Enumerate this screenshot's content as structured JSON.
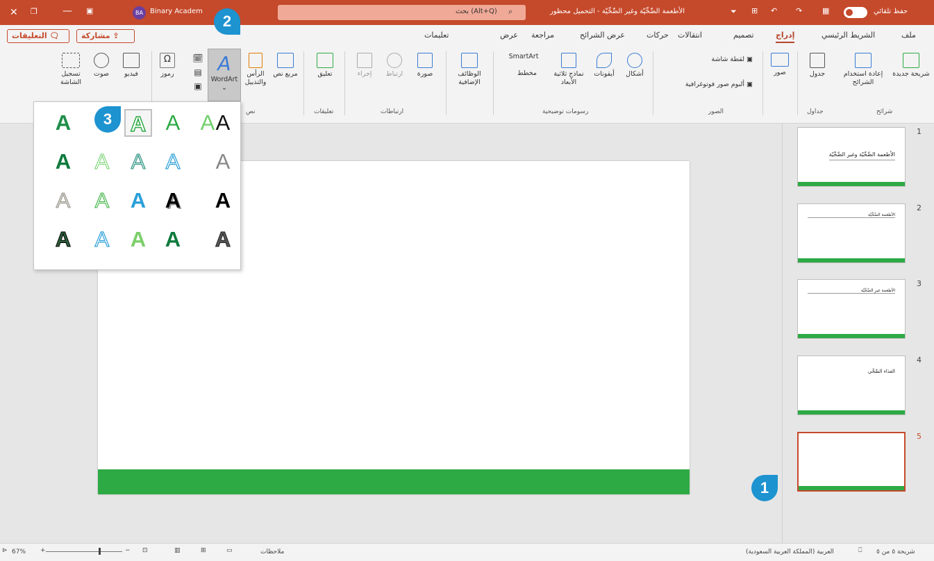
{
  "titlebar": {
    "autosave": "حفظ تلقائي",
    "doc_title": "الأطعمة الصِّحِّيّة وغير الصِّحِّيّة - التحميل محظور",
    "search_placeholder": "بحث (Alt+Q)",
    "user_initials": "BA",
    "user_name": "Binary Academ"
  },
  "menu": {
    "items": [
      "ملف",
      "الشريط الرئيسي",
      "إدراج",
      "تصميم",
      "انتقالات",
      "حركات",
      "عرض الشرائح",
      "مراجعة",
      "عرض",
      "تعليمات"
    ],
    "share": "مشاركة",
    "comments": "التعليقات"
  },
  "ribbon": {
    "new_slide": "شريحة جديدة",
    "reuse": "إعادة استخدام الشرائح",
    "table": "جدول",
    "images": "صور",
    "screenshot": "لقطة شاشة",
    "photo_album": "ألبوم صور فوتوغرافية",
    "shapes": "أشكال",
    "icons": "أيقونات",
    "models_3d": "نماذج ثلاثية الأبعاد",
    "smartart": "SmartArt",
    "chart": "مخطط",
    "addins": "الوظائف الإضافية",
    "zoom": "صورة",
    "link": "ارتباط",
    "action": "إجراء",
    "comment": "تعليق",
    "textbox": "مربع نص",
    "header_footer": "الرأس والتذييل",
    "wordart": "WordArt",
    "symbols": "رموز",
    "video": "فيديو",
    "audio": "صوت",
    "screen_recording": "تسجيل الشاشة",
    "groups": {
      "slides": "شرائح",
      "tables": "جداول",
      "images": "الصور",
      "illustrations": "رسومات توضيحية",
      "links": "ارتباطات",
      "comments": "تعليقات",
      "text": "نص"
    }
  },
  "thumbnails": [
    {
      "num": "1",
      "text": "الأطعمة الصِّحِّيّة وغير الصِّحِّيّة"
    },
    {
      "num": "2",
      "text": "الأطعمة الصِّحِّيّة"
    },
    {
      "num": "3",
      "text": "الأطعمة غير الصِّحِّيّة"
    },
    {
      "num": "4",
      "text": "الغذاء الصِّحِّي"
    },
    {
      "num": "5",
      "text": ""
    }
  ],
  "wordart_glyph": "A",
  "badges": [
    "1",
    "2",
    "3"
  ],
  "status": {
    "slide_info": "شريحة ٥ من ٥",
    "language": "العربية (المملكة العربية السعودية)",
    "notes": "ملاحظات",
    "zoom": "67%"
  },
  "colors": {
    "accent": "#c5492b",
    "green": "#2eaa45",
    "badge": "#1d93d0"
  }
}
